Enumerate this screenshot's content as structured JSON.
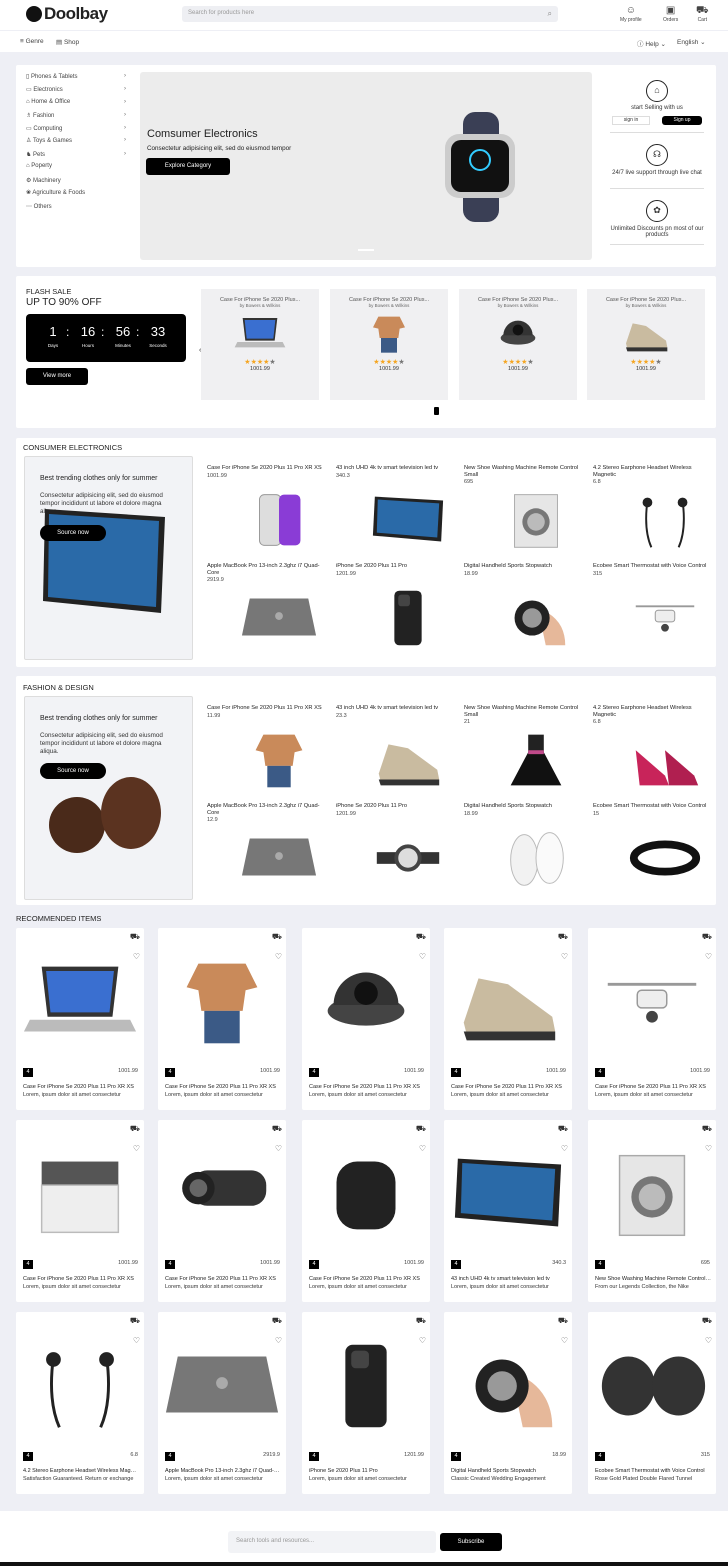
{
  "header": {
    "brand": "Doolbay",
    "search_placeholder": "Search for products here",
    "profile": "My profile",
    "orders": "Orders",
    "cart": "Cart"
  },
  "nav": {
    "genre": "Genre",
    "shop": "Shop",
    "help": "Help",
    "language": "English"
  },
  "categories": [
    "Phones & Tablets",
    "Electronics",
    "Home & Office",
    "Fashion",
    "Computing",
    "Toys & Games",
    "Pets",
    "Poperty",
    "Machinery",
    "Agriculture & Foods",
    "Others"
  ],
  "banner": {
    "title": "Comsumer Electronics",
    "subtitle": "Consectetur adipisicing elit, sed do eiusmod tempor",
    "button": "Explore Category"
  },
  "side": {
    "sell": "start Selling with us",
    "signin": "sign in",
    "signup": "Sign up",
    "support": "24/7 live support through live chat",
    "discount": "Unlimited Discounts pn most of our products"
  },
  "flash": {
    "label": "FLASH SALE",
    "headline": "UP TO 90% OFF",
    "days": "1",
    "hours": "16",
    "minutes": "56",
    "seconds": "33",
    "l_days": "Days",
    "l_hours": "Hours",
    "l_minutes": "Minutes",
    "l_seconds": "Seconds",
    "view_more": "View more",
    "products": [
      {
        "title": "Case For iPhone Se 2020 Plus...",
        "by": "by Bowers & Wilkins",
        "price": "1001.99",
        "rating": 4
      },
      {
        "title": "Case For iPhone Se 2020 Plus...",
        "by": "by Bowers & Wilkins",
        "price": "1001.99",
        "rating": 4
      },
      {
        "title": "Case For iPhone Se 2020 Plus...",
        "by": "by Bowers & Wilkins",
        "price": "1001.99",
        "rating": 4
      },
      {
        "title": "Case For iPhone Se 2020 Plus...",
        "by": "by Bowers & Wilkins",
        "price": "1001.99",
        "rating": 4
      }
    ]
  },
  "consumer": {
    "title": "CONSUMER ELECTRONICS",
    "promo_head": "Best trending clothes only for summer",
    "promo_text": "Consectetur adipisicing elit, sed do eiusmod tempor incididunt ut labore et dolore magna aliqua.",
    "promo_btn": "Source now",
    "items": [
      {
        "name": "Case For iPhone Se 2020 Plus 11 Pro XR XS",
        "price": "1001.99"
      },
      {
        "name": "43 inch UHD 4k tv smart television led tv",
        "price": "340.3"
      },
      {
        "name": "New Shoe Washing Machine Remote Control Small",
        "price": "695"
      },
      {
        "name": "4.2 Stereo Earphone Headset Wireless Magnetic",
        "price": "6.8"
      },
      {
        "name": "Apple MacBook Pro 13-inch 2.3ghz i7 Quad-Core",
        "price": "2919.9"
      },
      {
        "name": "iPhone Se 2020 Plus 11 Pro",
        "price": "1201.99"
      },
      {
        "name": "Digital Handheld Sports Stopwatch",
        "price": "18.99"
      },
      {
        "name": "Ecobee Smart Thermostat with Voice Control",
        "price": "315"
      }
    ]
  },
  "fashion": {
    "title": "FASHION & DESIGN",
    "promo_head": "Best trending clothes only for summer",
    "promo_text": "Consectetur adipisicing elit, sed do eiusmod tempor incididunt ut labore et dolore magna aliqua.",
    "promo_btn": "Source now",
    "items": [
      {
        "name": "Case For iPhone Se 2020 Plus 11 Pro XR XS",
        "price": "11.99"
      },
      {
        "name": "43 inch UHD 4k tv smart television led tv",
        "price": "23.3"
      },
      {
        "name": "New Shoe Washing Machine Remote Control Small",
        "price": "21"
      },
      {
        "name": "4.2 Stereo Earphone Headset Wireless Magnetic",
        "price": "6.8"
      },
      {
        "name": "Apple MacBook Pro 13-inch 2.3ghz i7 Quad-Core",
        "price": "12.9"
      },
      {
        "name": "iPhone Se 2020 Plus 11 Pro",
        "price": "1201.99"
      },
      {
        "name": "Digital Handheld Sports Stopwatch",
        "price": "18.99"
      },
      {
        "name": "Ecobee Smart Thermostat with Voice Control",
        "price": "15"
      }
    ]
  },
  "recommended": {
    "title": "RECOMMENDED ITEMS",
    "items": [
      {
        "qty": "4",
        "price": "1001.99",
        "name": "Case For iPhone Se 2020 Plus 11 Pro XR XS",
        "desc": "Lorem, ipsum dolor sit amet consectetur"
      },
      {
        "qty": "4",
        "price": "1001.99",
        "name": "Case For iPhone Se 2020 Plus 11 Pro XR XS",
        "desc": "Lorem, ipsum dolor sit amet consectetur"
      },
      {
        "qty": "4",
        "price": "1001.99",
        "name": "Case For iPhone Se 2020 Plus 11 Pro XR XS",
        "desc": "Lorem, ipsum dolor sit amet consectetur"
      },
      {
        "qty": "4",
        "price": "1001.99",
        "name": "Case For iPhone Se 2020 Plus 11 Pro XR XS",
        "desc": "Lorem, ipsum dolor sit amet consectetur"
      },
      {
        "qty": "4",
        "price": "1001.99",
        "name": "Case For iPhone Se 2020 Plus 11 Pro XR XS",
        "desc": "Lorem, ipsum dolor sit amet consectetur"
      },
      {
        "qty": "4",
        "price": "1001.99",
        "name": "Case For iPhone Se 2020 Plus 11 Pro XR XS",
        "desc": "Lorem, ipsum dolor sit amet consectetur"
      },
      {
        "qty": "4",
        "price": "1001.99",
        "name": "Case For iPhone Se 2020 Plus 11 Pro XR XS",
        "desc": "Lorem, ipsum dolor sit amet consectetur"
      },
      {
        "qty": "4",
        "price": "1001.99",
        "name": "Case For iPhone Se 2020 Plus 11 Pro XR XS",
        "desc": "Lorem, ipsum dolor sit amet consectetur"
      },
      {
        "qty": "4",
        "price": "340.3",
        "name": "43 inch UHD 4k tv smart television led tv",
        "desc": "Lorem, ipsum dolor sit amet consectetur"
      },
      {
        "qty": "4",
        "price": "695",
        "name": "New Shoe Washing Machine Remote Control Small",
        "desc": "From our Legends Collection, the Nike"
      },
      {
        "qty": "4",
        "price": "6.8",
        "name": "4.2 Stereo Earphone Headset Wireless Magnetic",
        "desc": "Satisfaction Guaranteed. Return or exchange"
      },
      {
        "qty": "4",
        "price": "2919.9",
        "name": "Apple MacBook Pro 13-inch 2.3ghz i7 Quad-Core",
        "desc": "Lorem, ipsum dolor sit amet consectetur"
      },
      {
        "qty": "4",
        "price": "1201.99",
        "name": "iPhone Se 2020 Plus 11 Pro",
        "desc": "Lorem, ipsum dolor sit amet consectetur"
      },
      {
        "qty": "4",
        "price": "18.99",
        "name": "Digital Handheld Sports Stopwatch",
        "desc": "Classic Created Wedding Engagement"
      },
      {
        "qty": "4",
        "price": "315",
        "name": "Ecobee Smart Thermostat with Voice Control",
        "desc": "Rose Gold Plated Double Flared Tunnel"
      }
    ]
  },
  "footer": {
    "placeholder": "Search tools and resources...",
    "button": "Subscribe"
  }
}
